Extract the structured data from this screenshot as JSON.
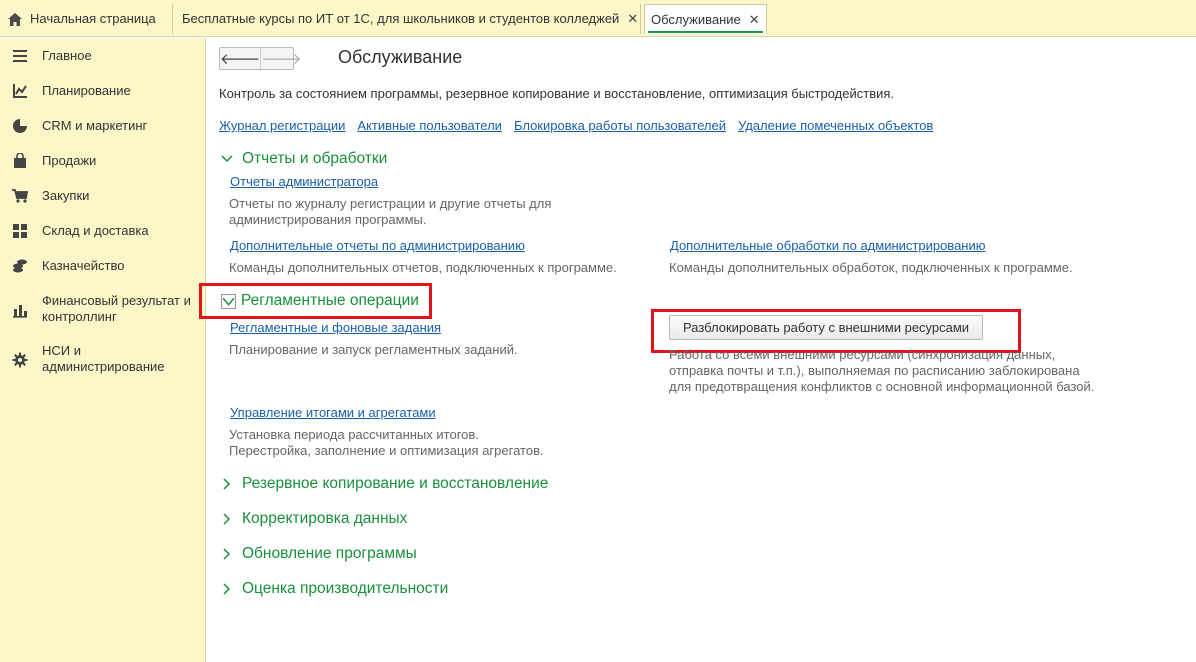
{
  "tabs": [
    {
      "label": "Начальная страница"
    },
    {
      "label": "Бесплатные курсы по ИТ от 1С, для школьников и студентов колледжей"
    },
    {
      "label": "Обслуживание"
    }
  ],
  "sidebar": {
    "items": [
      {
        "label": "Главное",
        "icon": "menu-lines-icon"
      },
      {
        "label": "Планирование",
        "icon": "planning-chart-icon"
      },
      {
        "label": "CRM и маркетинг",
        "icon": "pie-chart-icon"
      },
      {
        "label": "Продажи",
        "icon": "shopping-bag-icon"
      },
      {
        "label": "Закупки",
        "icon": "cart-icon"
      },
      {
        "label": "Склад и доставка",
        "icon": "warehouse-grid-icon"
      },
      {
        "label": "Казначейство",
        "icon": "coins-icon"
      },
      {
        "label": "Финансовый результат и контроллинг",
        "icon": "bar-chart-icon"
      },
      {
        "label": "НСИ и администрирование",
        "icon": "gear-icon"
      }
    ]
  },
  "page": {
    "title": "Обслуживание",
    "description": "Контроль за состоянием программы, резервное копирование и восстановление, оптимизация быстродействия.",
    "top_links": [
      "Журнал регистрации",
      "Активные пользователи",
      "Блокировка работы пользователей",
      "Удаление помеченных объектов"
    ]
  },
  "sections": {
    "reports": {
      "title": "Отчеты и обработки",
      "admin_reports_link": "Отчеты администратора",
      "admin_reports_desc": [
        "Отчеты по журналу регистрации и другие отчеты для",
        "администрирования программы."
      ],
      "extra_reports_link": "Дополнительные отчеты по администрированию",
      "extra_reports_desc": "Команды дополнительных отчетов, подключенных к программе.",
      "extra_processing_link": "Дополнительные обработки по администрированию",
      "extra_processing_desc": "Команды дополнительных обработок, подключенных к программе."
    },
    "scheduled": {
      "title": "Регламентные операции",
      "jobs_link": "Регламентные и фоновые задания",
      "jobs_desc": "Планирование и запуск регламентных заданий.",
      "unlock_button": "Разблокировать работу с внешними ресурсами",
      "unlock_desc": [
        "Работа со всеми внешними ресурсами (синхронизация данных,",
        "отправка почты и т.п.), выполняемая по расписанию заблокирована",
        "для предотвращения конфликтов с основной информационной базой."
      ],
      "totals_link": "Управление итогами и агрегатами",
      "totals_desc": [
        "Установка периода рассчитанных итогов.",
        "Перестройка, заполнение и оптимизация агрегатов."
      ]
    },
    "collapsed": [
      "Резервное копирование и восстановление",
      "Корректировка данных",
      "Обновление программы",
      "Оценка производительности"
    ]
  },
  "colors": {
    "accent_green": "#1a8f3c",
    "link_blue": "#1a5fa8",
    "panel_yellow": "#fbf7c8",
    "highlight_red": "#e0141a"
  }
}
